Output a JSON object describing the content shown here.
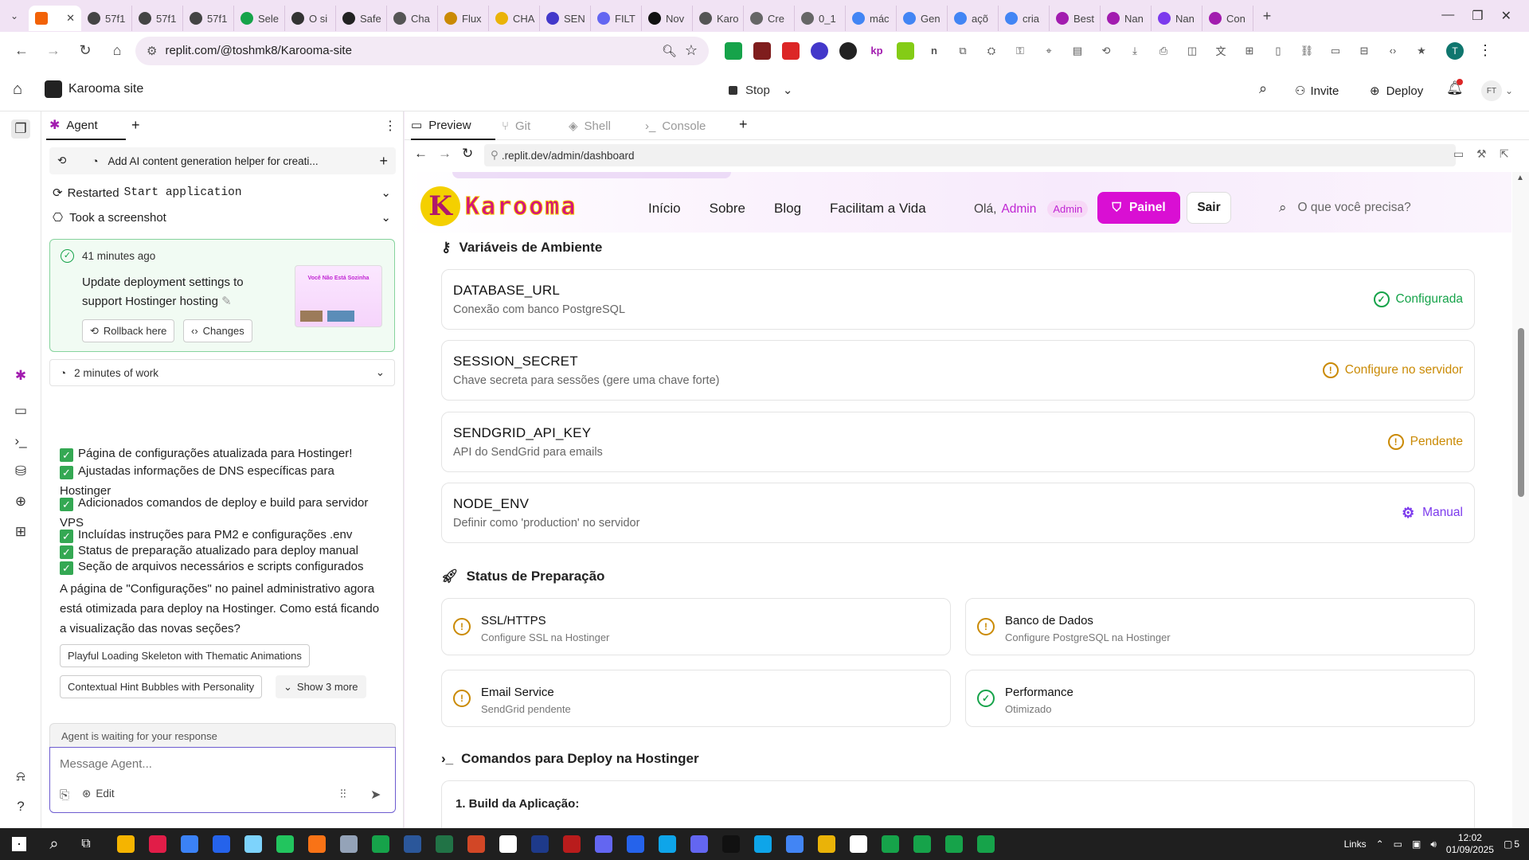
{
  "browser": {
    "tabs": [
      "57f1",
      "57f1",
      "57f1",
      "Sele",
      "O si",
      "Safe",
      "Cha",
      "Flux",
      "CHA",
      "SEN",
      "FILT",
      "Nov",
      "Karo",
      "Cre",
      "0_1",
      "mác",
      "Gen",
      "açõ",
      "cria",
      "Best",
      "Nan",
      "Nan",
      "Con"
    ],
    "url": "replit.com/@toshmk8/Karooma-site",
    "profile_initial": "T"
  },
  "replit": {
    "project_name": "Karooma site",
    "stop_label": "Stop",
    "invite_label": "Invite",
    "deploy_label": "Deploy",
    "user_initials": "FT"
  },
  "agent": {
    "tab_label": "Agent",
    "checkpoint_title": "Add AI content generation helper for creati...",
    "restarted_label": "Restarted",
    "restarted_code": "Start application",
    "screenshot_label": "Took a screenshot",
    "time_ago": "41 minutes ago",
    "commit_message": "Update deployment settings to support Hostinger hosting",
    "rollback_label": "Rollback here",
    "changes_label": "Changes",
    "work_duration": "2 minutes of work",
    "tasks": [
      "Página de configurações atualizada para Hostinger!",
      "Ajustadas informações de DNS específicas para Hostinger",
      "Adicionados comandos de deploy e build para servidor VPS",
      "Incluídas instruções para PM2 e configurações .env",
      "Status de preparação atualizado para deploy manual",
      "Seção de arquivos necessários e scripts configurados"
    ],
    "summary": "A página de \"Configurações\" no painel administrativo agora está otimizada para deploy na Hostinger. Como está ficando a visualização das novas seções?",
    "suggestions": [
      "Playful Loading Skeleton with Thematic Animations",
      "Contextual Hint Bubbles with Personality"
    ],
    "show_more": "Show 3 more",
    "waiting": "Agent is waiting for your response",
    "input_placeholder": "Message Agent...",
    "edit_label": "Edit",
    "thumb_text": "Você Não Está Sozinha"
  },
  "workspace": {
    "tabs": [
      "Preview",
      "Git",
      "Shell",
      "Console"
    ],
    "preview_url": ".replit.dev/admin/dashboard"
  },
  "site": {
    "logo_text": "Karooma",
    "nav": [
      "Início",
      "Sobre",
      "Blog",
      "Facilitam a Vida"
    ],
    "greeting": "Olá,",
    "user_name": "Admin",
    "role_badge": "Admin",
    "panel_button": "Painel",
    "logout_button": "Sair",
    "search_placeholder": "O que você precisa?",
    "env_title": "Variáveis de Ambiente",
    "env_vars": [
      {
        "name": "DATABASE_URL",
        "desc": "Conexão com banco PostgreSQL",
        "status": "Configurada",
        "color": "#16a34a",
        "icon": "check-circle-icon"
      },
      {
        "name": "SESSION_SECRET",
        "desc": "Chave secreta para sessões (gere uma chave forte)",
        "status": "Configure no servidor",
        "color": "#ca8a04",
        "icon": "alert-circle-icon"
      },
      {
        "name": "SENDGRID_API_KEY",
        "desc": "API do SendGrid para emails",
        "status": "Pendente",
        "color": "#ca8a04",
        "icon": "alert-circle-icon"
      },
      {
        "name": "NODE_ENV",
        "desc": "Definir como 'production' no servidor",
        "status": "Manual",
        "color": "#7c3aed",
        "icon": "gear-icon"
      }
    ],
    "status_title": "Status de Preparação",
    "status_items": [
      {
        "title": "SSL/HTTPS",
        "desc": "Configure SSL na Hostinger",
        "icon": "alert-circle-icon"
      },
      {
        "title": "Banco de Dados",
        "desc": "Configure PostgreSQL na Hostinger",
        "icon": "alert-circle-icon"
      },
      {
        "title": "Email Service",
        "desc": "SendGrid pendente",
        "icon": "alert-circle-icon"
      },
      {
        "title": "Performance",
        "desc": "Otimizado",
        "icon": "check-circle-icon"
      }
    ],
    "deploy_title": "Comandos para Deploy na Hostinger",
    "deploy_step1": "1. Build da Aplicação:"
  },
  "taskbar": {
    "links_label": "Links",
    "time": "12:02",
    "date": "01/09/2025",
    "notif_count": "5"
  },
  "colors": {
    "accent": "#d90fd3",
    "replit_orange": "#f26207",
    "warn": "#ca8a04",
    "ok": "#16a34a",
    "manual": "#7c3aed"
  }
}
